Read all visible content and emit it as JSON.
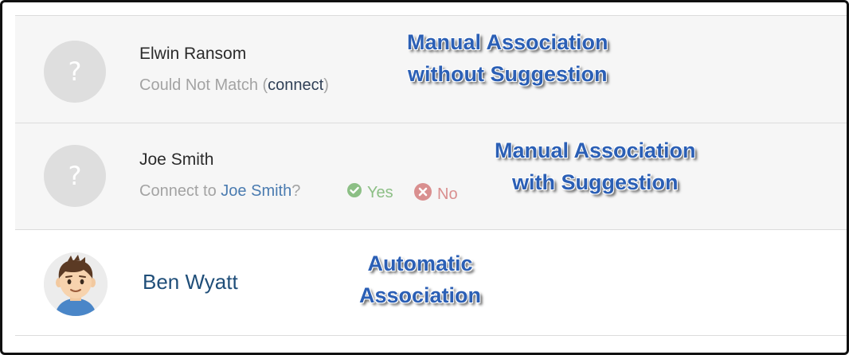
{
  "rows": [
    {
      "name": "Elwin Ransom",
      "avatar_icon": "question-mark-icon",
      "avatar_glyph": "?",
      "status_prefix": "Could Not Match (",
      "status_link": "connect",
      "status_suffix": ")"
    },
    {
      "name": "Joe Smith",
      "avatar_icon": "question-mark-icon",
      "avatar_glyph": "?",
      "status_prefix": "Connect to ",
      "suggestion": "Joe Smith",
      "suggestion_suffix": "?",
      "yes_label": "Yes",
      "no_label": "No",
      "yes_icon": "check-circle-icon",
      "no_icon": "x-circle-icon"
    },
    {
      "name": "Ben Wyatt",
      "avatar_icon": "user-photo-avatar"
    }
  ],
  "callouts": [
    {
      "line1": "Manual Association",
      "line2": "without Suggestion"
    },
    {
      "line1": "Manual Association",
      "line2": "with Suggestion"
    },
    {
      "line1": "Automatic",
      "line2": "Association"
    }
  ],
  "colors": {
    "callout_text": "#2b5fb5",
    "link": "#1f4e79",
    "yes": "#8cbf85",
    "no": "#d98f8f",
    "muted": "#a3a3a3"
  }
}
